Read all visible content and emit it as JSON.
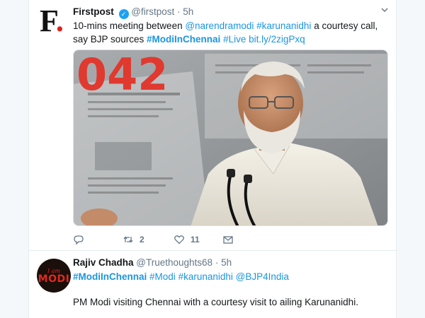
{
  "tweets": [
    {
      "author_name": "Firstpost",
      "handle": "@firstpost",
      "separator": "·",
      "time": "5h",
      "avatar_letter": "F",
      "avatar_dot": ".",
      "verified_mark": "✓",
      "text_parts": {
        "t1": "10-mins meeting between ",
        "m1": "@narendramodi",
        "sp1": " ",
        "h1": "#karunanidhi",
        "t2": " a courtesy call, say BJP sources ",
        "h2": "#ModiInChennai",
        "sp2": " ",
        "h3": "#Live",
        "sp3": " ",
        "link": "bit.ly/2zigPxq"
      },
      "media_numbers": "042",
      "actions": {
        "reply_count": "",
        "retweet_count": "2",
        "like_count": "11"
      }
    },
    {
      "author_name": "Rajiv Chadha",
      "handle": "@Truethoughts68",
      "separator": "·",
      "time": "5h",
      "avatar_text_small": "I am",
      "avatar_text_big": "MODI",
      "hashtags": {
        "h1": "#ModiInChennai",
        "h2": "#Modi",
        "h3": "#karunanidhi",
        "h4": "@BJP4India"
      },
      "body": "PM Modi visiting Chennai with a courtesy visit to ailing Karunanidhi."
    }
  ],
  "icons": {
    "chevron": "chevron-down-icon",
    "reply": "reply-icon",
    "retweet": "retweet-icon",
    "like": "heart-icon",
    "dm": "envelope-icon"
  },
  "colors": {
    "link": "#1b95e0",
    "verified": "#1da1f2",
    "text": "#14171a",
    "muted": "#657786",
    "firstpost_dot": "#e0201c"
  }
}
